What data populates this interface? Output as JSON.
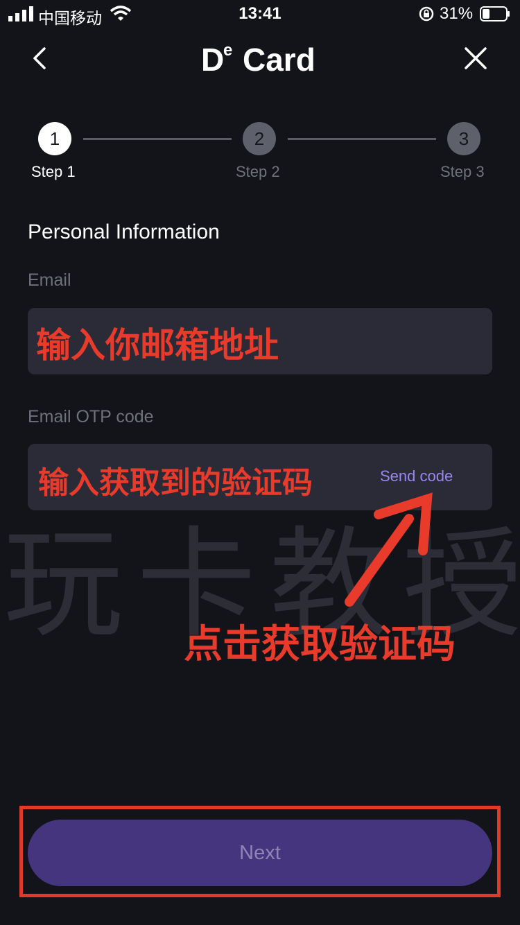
{
  "status_bar": {
    "carrier": "中国移动",
    "time": "13:41",
    "battery": "31%"
  },
  "nav": {
    "logo_main": "D",
    "logo_sup": "e",
    "logo_rest": "Card",
    "icons": [
      "back-icon",
      "close-icon"
    ]
  },
  "stepper": {
    "steps": [
      {
        "number": "1",
        "label": "Step 1",
        "active": true
      },
      {
        "number": "2",
        "label": "Step 2",
        "active": false
      },
      {
        "number": "3",
        "label": "Step 3",
        "active": false
      }
    ]
  },
  "form": {
    "section_title": "Personal Information",
    "email_label": "Email",
    "email_overlay_text": "输入你邮箱地址",
    "otp_label": "Email OTP code",
    "otp_overlay_text": "输入获取到的验证码",
    "send_code": "Send code"
  },
  "annotation": {
    "watermark": "玩卡教授",
    "hint": "点击获取验证码"
  },
  "footer": {
    "next_label": "Next"
  },
  "colors": {
    "background": "#131419",
    "field_bg": "#2a2b37",
    "accent": "#9a86f0",
    "button_bg": "#45357f",
    "annotation_red": "#e83b2b"
  }
}
